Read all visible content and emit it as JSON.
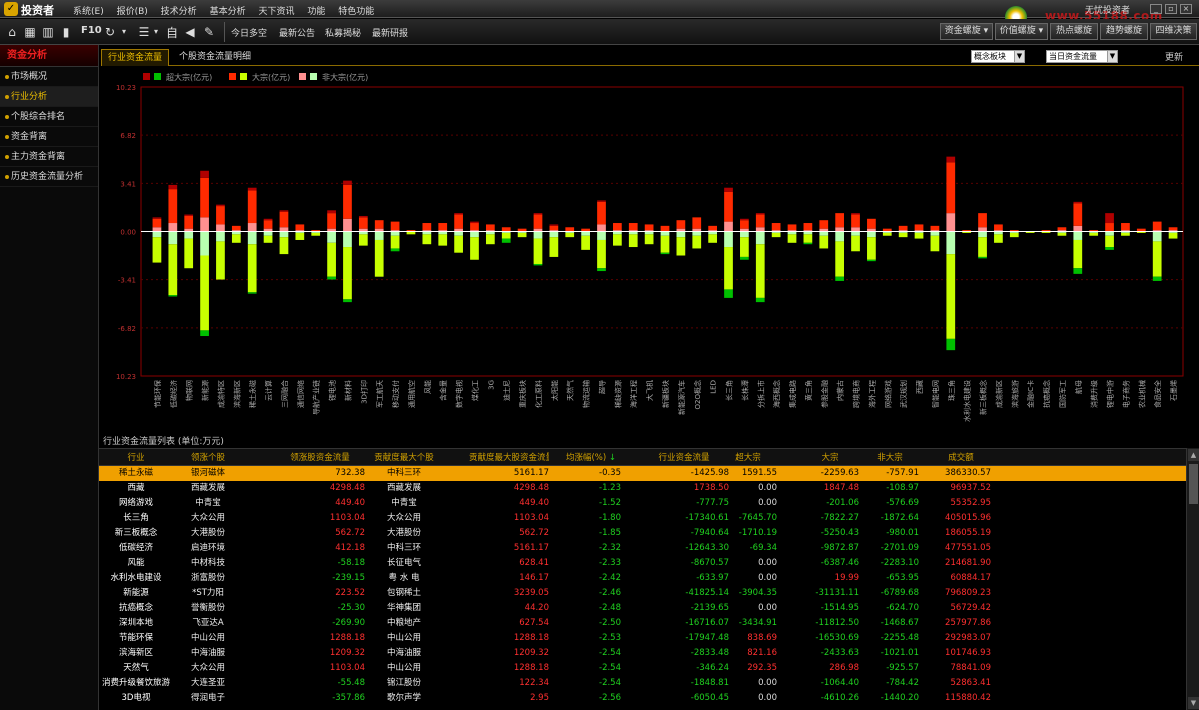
{
  "app": {
    "title": "投资者",
    "user": "无忧投资者",
    "site": "www.55188.com"
  },
  "menu": [
    "系统(E)",
    "报价(B)",
    "技术分析",
    "基本分析",
    "天下资讯",
    "功能",
    "特色功能"
  ],
  "toolbar": {
    "f10": "F10",
    "zi": "自",
    "links": [
      "今日多空",
      "最新公告",
      "私募揭秘",
      "最新研报"
    ],
    "right_buttons": [
      "资金螺旋",
      "价值螺旋",
      "热点螺旋",
      "趋势螺旋",
      "四维决策"
    ]
  },
  "sidebar": {
    "title": "资金分析",
    "items": [
      "市场概况",
      "行业分析",
      "个股综合排名",
      "资金背离",
      "主力资金背离",
      "历史资金流量分析"
    ],
    "active_index": 1
  },
  "tabs": [
    "行业资金流量",
    "个股资金流量明细"
  ],
  "selects": {
    "sector": "概念板块",
    "period": "当日资金流量"
  },
  "refresh_label": "更新",
  "colors": {
    "big_in": "#ff2a00",
    "big_out": "#c8ff00",
    "super_in": "#b00000",
    "super_out": "#00c000",
    "mid_in": "#ff9090",
    "mid_out": "#b8ffb0",
    "accent": "#f0a000",
    "row_select": "#f0a000"
  },
  "chart_data": {
    "type": "bar",
    "legend": [
      {
        "name": "超大宗(亿元)",
        "colors": [
          "#b00000",
          "#00c000"
        ]
      },
      {
        "name": "大宗(亿元)",
        "colors": [
          "#ff2a00",
          "#c8ff00"
        ]
      },
      {
        "name": "非大宗(亿元)",
        "colors": [
          "#ff9090",
          "#b8ffb0"
        ]
      }
    ],
    "yticks": [
      "10.23",
      "6.82",
      "3.41",
      "0.00",
      "-3.41",
      "-6.82",
      "10.23"
    ],
    "ylim": [
      -10.23,
      10.23
    ],
    "categories": [
      "节能环保",
      "低碳经济",
      "物联网",
      "新能源",
      "成渝特区",
      "滨海新区",
      "稀土永磁",
      "云计算",
      "三网融合",
      "通信网络",
      "导航产业链",
      "锂电池",
      "新材料",
      "3D打印",
      "军工航天",
      "移动支付",
      "通用航空",
      "风能",
      "含金量",
      "数字电视",
      "煤化工",
      "3G",
      "迪士尼",
      "重庆板块",
      "化工原料",
      "太阳能",
      "天然气",
      "物流运输",
      "超导",
      "稀缺资源",
      "海洋工程",
      "大飞机",
      "新疆板块",
      "新能源汽车",
      "O2O概念",
      "LED",
      "长三角",
      "长株潭",
      "分拆上市",
      "海西概念",
      "集成电路",
      "黄三角",
      "参股金融",
      "内蒙古",
      "跨境电商",
      "海外工程",
      "网络游戏",
      "武汉规划",
      "西藏",
      "智能电网",
      "珠三角",
      "水利水电建设",
      "新三板概念",
      "成渝新区",
      "滨海旅游",
      "金融IC卡",
      "抗癌概念",
      "国防军工",
      "航母",
      "消费升级",
      "锂电中游",
      "电子商务",
      "农业机械",
      "食品安全",
      "石墨烯"
    ],
    "series": [
      {
        "name": "超大宗流入",
        "values": [
          0.1,
          0.3,
          0.1,
          0.5,
          0.1,
          0.0,
          0.2,
          0.1,
          0.1,
          0.0,
          0.0,
          0.2,
          0.3,
          0.1,
          0.0,
          0.0,
          0.0,
          0.0,
          0.0,
          0.1,
          0.1,
          0.0,
          0.0,
          0.0,
          0.1,
          0.1,
          0.0,
          0.0,
          0.1,
          0.0,
          0.0,
          0.0,
          0.0,
          0.0,
          0.0,
          0.0,
          0.3,
          0.1,
          0.1,
          0.0,
          0.0,
          0.0,
          0.0,
          0.0,
          0.1,
          0.0,
          0.0,
          0.0,
          0.0,
          0.0,
          0.4,
          0.0,
          0.0,
          0.0,
          0.0,
          0.0,
          0.0,
          0.0,
          0.1,
          0.0,
          0.7,
          0.0,
          0.0,
          0.0,
          0.0
        ]
      },
      {
        "name": "大宗流入",
        "values": [
          0.6,
          2.4,
          0.9,
          2.8,
          1.3,
          0.3,
          2.3,
          0.6,
          1.1,
          0.4,
          0.1,
          1.1,
          2.4,
          0.8,
          0.6,
          0.6,
          0.1,
          0.5,
          0.5,
          1.0,
          0.5,
          0.4,
          0.3,
          0.2,
          1.0,
          0.3,
          0.3,
          0.2,
          1.6,
          0.5,
          0.5,
          0.4,
          0.4,
          0.6,
          0.8,
          0.3,
          2.1,
          0.6,
          0.9,
          0.5,
          0.4,
          0.5,
          0.6,
          1.0,
          0.9,
          0.7,
          0.2,
          0.3,
          0.4,
          0.3,
          3.6,
          0.1,
          1.0,
          0.4,
          0.1,
          0.0,
          0.1,
          0.2,
          1.6,
          0.1,
          0.6,
          0.5,
          0.2,
          0.6,
          0.2
        ]
      },
      {
        "name": "非大宗流入",
        "values": [
          0.3,
          0.6,
          0.2,
          1.0,
          0.5,
          0.1,
          0.6,
          0.2,
          0.3,
          0.1,
          0.0,
          0.2,
          0.9,
          0.2,
          0.2,
          0.1,
          0.0,
          0.1,
          0.1,
          0.2,
          0.1,
          0.1,
          0.0,
          0.0,
          0.2,
          0.1,
          0.0,
          0.0,
          0.5,
          0.1,
          0.1,
          0.1,
          0.0,
          0.2,
          0.2,
          0.1,
          0.7,
          0.2,
          0.3,
          0.1,
          0.1,
          0.1,
          0.2,
          0.3,
          0.3,
          0.2,
          0.0,
          0.1,
          0.1,
          0.1,
          1.3,
          0.0,
          0.3,
          0.1,
          0.0,
          0.0,
          0.0,
          0.1,
          0.4,
          0.0,
          0.0,
          0.1,
          0.0,
          0.1,
          0.1
        ]
      },
      {
        "name": "超大宗流出",
        "values": [
          0.0,
          0.1,
          0.0,
          0.4,
          0.0,
          0.0,
          0.1,
          0.0,
          0.0,
          0.0,
          0.0,
          0.2,
          0.2,
          0.0,
          0.0,
          0.2,
          0.0,
          0.0,
          0.0,
          0.0,
          0.0,
          0.0,
          0.3,
          0.0,
          0.1,
          0.0,
          0.0,
          0.0,
          0.2,
          0.0,
          0.0,
          0.0,
          0.1,
          0.0,
          0.0,
          0.0,
          0.6,
          0.2,
          0.3,
          0.0,
          0.0,
          0.1,
          0.0,
          0.3,
          0.0,
          0.1,
          0.0,
          0.0,
          0.0,
          0.0,
          0.8,
          0.0,
          0.1,
          0.0,
          0.0,
          0.0,
          0.0,
          0.0,
          0.4,
          0.0,
          0.2,
          0.0,
          0.0,
          0.3,
          0.0
        ]
      },
      {
        "name": "大宗流出",
        "values": [
          1.8,
          3.6,
          2.1,
          5.3,
          2.7,
          0.6,
          3.4,
          0.5,
          1.2,
          0.5,
          0.2,
          2.4,
          3.7,
          0.8,
          2.6,
          0.9,
          0.2,
          0.7,
          0.8,
          1.2,
          1.6,
          0.7,
          0.4,
          0.3,
          1.8,
          1.4,
          0.3,
          1.0,
          2.0,
          0.8,
          0.9,
          0.7,
          1.2,
          1.3,
          0.9,
          0.6,
          3.0,
          1.4,
          3.8,
          0.3,
          0.6,
          0.6,
          0.9,
          2.5,
          1.1,
          1.6,
          0.2,
          0.3,
          0.4,
          1.1,
          6.0,
          0.1,
          1.4,
          0.6,
          0.3,
          0.1,
          0.1,
          0.2,
          2.0,
          0.2,
          0.8,
          0.2,
          0.1,
          2.5,
          0.4
        ]
      },
      {
        "name": "非大宗流出",
        "values": [
          0.4,
          0.9,
          0.5,
          1.7,
          0.7,
          0.2,
          0.9,
          0.3,
          0.4,
          0.1,
          0.1,
          0.8,
          1.1,
          0.2,
          0.6,
          0.3,
          0.0,
          0.2,
          0.2,
          0.3,
          0.4,
          0.2,
          0.1,
          0.1,
          0.5,
          0.4,
          0.1,
          0.3,
          0.6,
          0.2,
          0.2,
          0.2,
          0.3,
          0.4,
          0.3,
          0.2,
          1.1,
          0.4,
          0.9,
          0.1,
          0.2,
          0.2,
          0.3,
          0.7,
          0.3,
          0.4,
          0.1,
          0.1,
          0.1,
          0.3,
          1.6,
          0.0,
          0.4,
          0.2,
          0.1,
          0.0,
          0.0,
          0.1,
          0.6,
          0.1,
          0.3,
          0.1,
          0.0,
          0.7,
          0.1
        ]
      }
    ]
  },
  "table": {
    "caption": "行业资金流量列表 (单位:万元)",
    "columns": [
      "行业",
      "领涨个股",
      "领涨股资金流量",
      "贡献度最大个股",
      "贡献度最大股资金流量",
      "均涨幅(%)",
      "行业资金流量",
      "超大宗",
      "大宗",
      "非大宗",
      "成交额"
    ],
    "sort_icon": "arrow-down",
    "selected_index": 0,
    "rows": [
      [
        "稀土永磁",
        "银河磁体",
        "732.38",
        "中科三环",
        "5161.17",
        "-0.35",
        "-1425.98",
        "1591.55",
        "-2259.63",
        "-757.91",
        "386330.57"
      ],
      [
        "西藏",
        "西藏发展",
        "4298.48",
        "西藏发展",
        "4298.48",
        "-1.23",
        "1738.50",
        "0.00",
        "1847.48",
        "-108.97",
        "96937.52"
      ],
      [
        "网络游戏",
        "中青宝",
        "449.40",
        "中青宝",
        "449.40",
        "-1.52",
        "-777.75",
        "0.00",
        "-201.06",
        "-576.69",
        "55352.95"
      ],
      [
        "长三角",
        "大众公用",
        "1103.04",
        "大众公用",
        "1103.04",
        "-1.80",
        "-17340.61",
        "-7645.70",
        "-7822.27",
        "-1872.64",
        "405015.96"
      ],
      [
        "新三板概念",
        "大港股份",
        "562.72",
        "大港股份",
        "562.72",
        "-1.85",
        "-7940.64",
        "-1710.19",
        "-5250.43",
        "-980.01",
        "186055.19"
      ],
      [
        "低碳经济",
        "启迪环境",
        "412.18",
        "中科三环",
        "5161.17",
        "-2.32",
        "-12643.30",
        "-69.34",
        "-9872.87",
        "-2701.09",
        "477551.05"
      ],
      [
        "风能",
        "中材科技",
        "-58.18",
        "长征电气",
        "628.41",
        "-2.33",
        "-8670.57",
        "0.00",
        "-6387.46",
        "-2283.10",
        "214681.90"
      ],
      [
        "水利水电建设",
        "浙富股份",
        "-239.15",
        "粤 水 电",
        "146.17",
        "-2.42",
        "-633.97",
        "0.00",
        "19.99",
        "-653.95",
        "60884.17"
      ],
      [
        "新能源",
        "*ST力阳",
        "223.52",
        "包钢稀土",
        "3239.05",
        "-2.46",
        "-41825.14",
        "-3904.35",
        "-31131.11",
        "-6789.68",
        "796809.23"
      ],
      [
        "抗癌概念",
        "誉衡股份",
        "-25.30",
        "华神集团",
        "44.20",
        "-2.48",
        "-2139.65",
        "0.00",
        "-1514.95",
        "-624.70",
        "56729.42"
      ],
      [
        "深圳本地",
        "飞亚达A",
        "-269.90",
        "中粮地产",
        "627.54",
        "-2.50",
        "-16716.07",
        "-3434.91",
        "-11812.50",
        "-1468.67",
        "257977.86"
      ],
      [
        "节能环保",
        "中山公用",
        "1288.18",
        "中山公用",
        "1288.18",
        "-2.53",
        "-17947.48",
        "838.69",
        "-16530.69",
        "-2255.48",
        "292983.07"
      ],
      [
        "滨海新区",
        "中海油服",
        "1209.32",
        "中海油服",
        "1209.32",
        "-2.54",
        "-2833.48",
        "821.16",
        "-2433.63",
        "-1021.01",
        "101746.93"
      ],
      [
        "天然气",
        "大众公用",
        "1103.04",
        "中山公用",
        "1288.18",
        "-2.54",
        "-346.24",
        "292.35",
        "286.98",
        "-925.57",
        "78841.09"
      ],
      [
        "消费升级餐饮旅游",
        "大连圣亚",
        "-55.48",
        "锦江股份",
        "122.34",
        "-2.54",
        "-1848.81",
        "0.00",
        "-1064.40",
        "-784.42",
        "52863.41"
      ],
      [
        "3D电视",
        "得润电子",
        "-357.86",
        "歌尔声学",
        "2.95",
        "-2.56",
        "-6050.45",
        "0.00",
        "-4610.26",
        "-1440.20",
        "115880.42"
      ]
    ]
  }
}
